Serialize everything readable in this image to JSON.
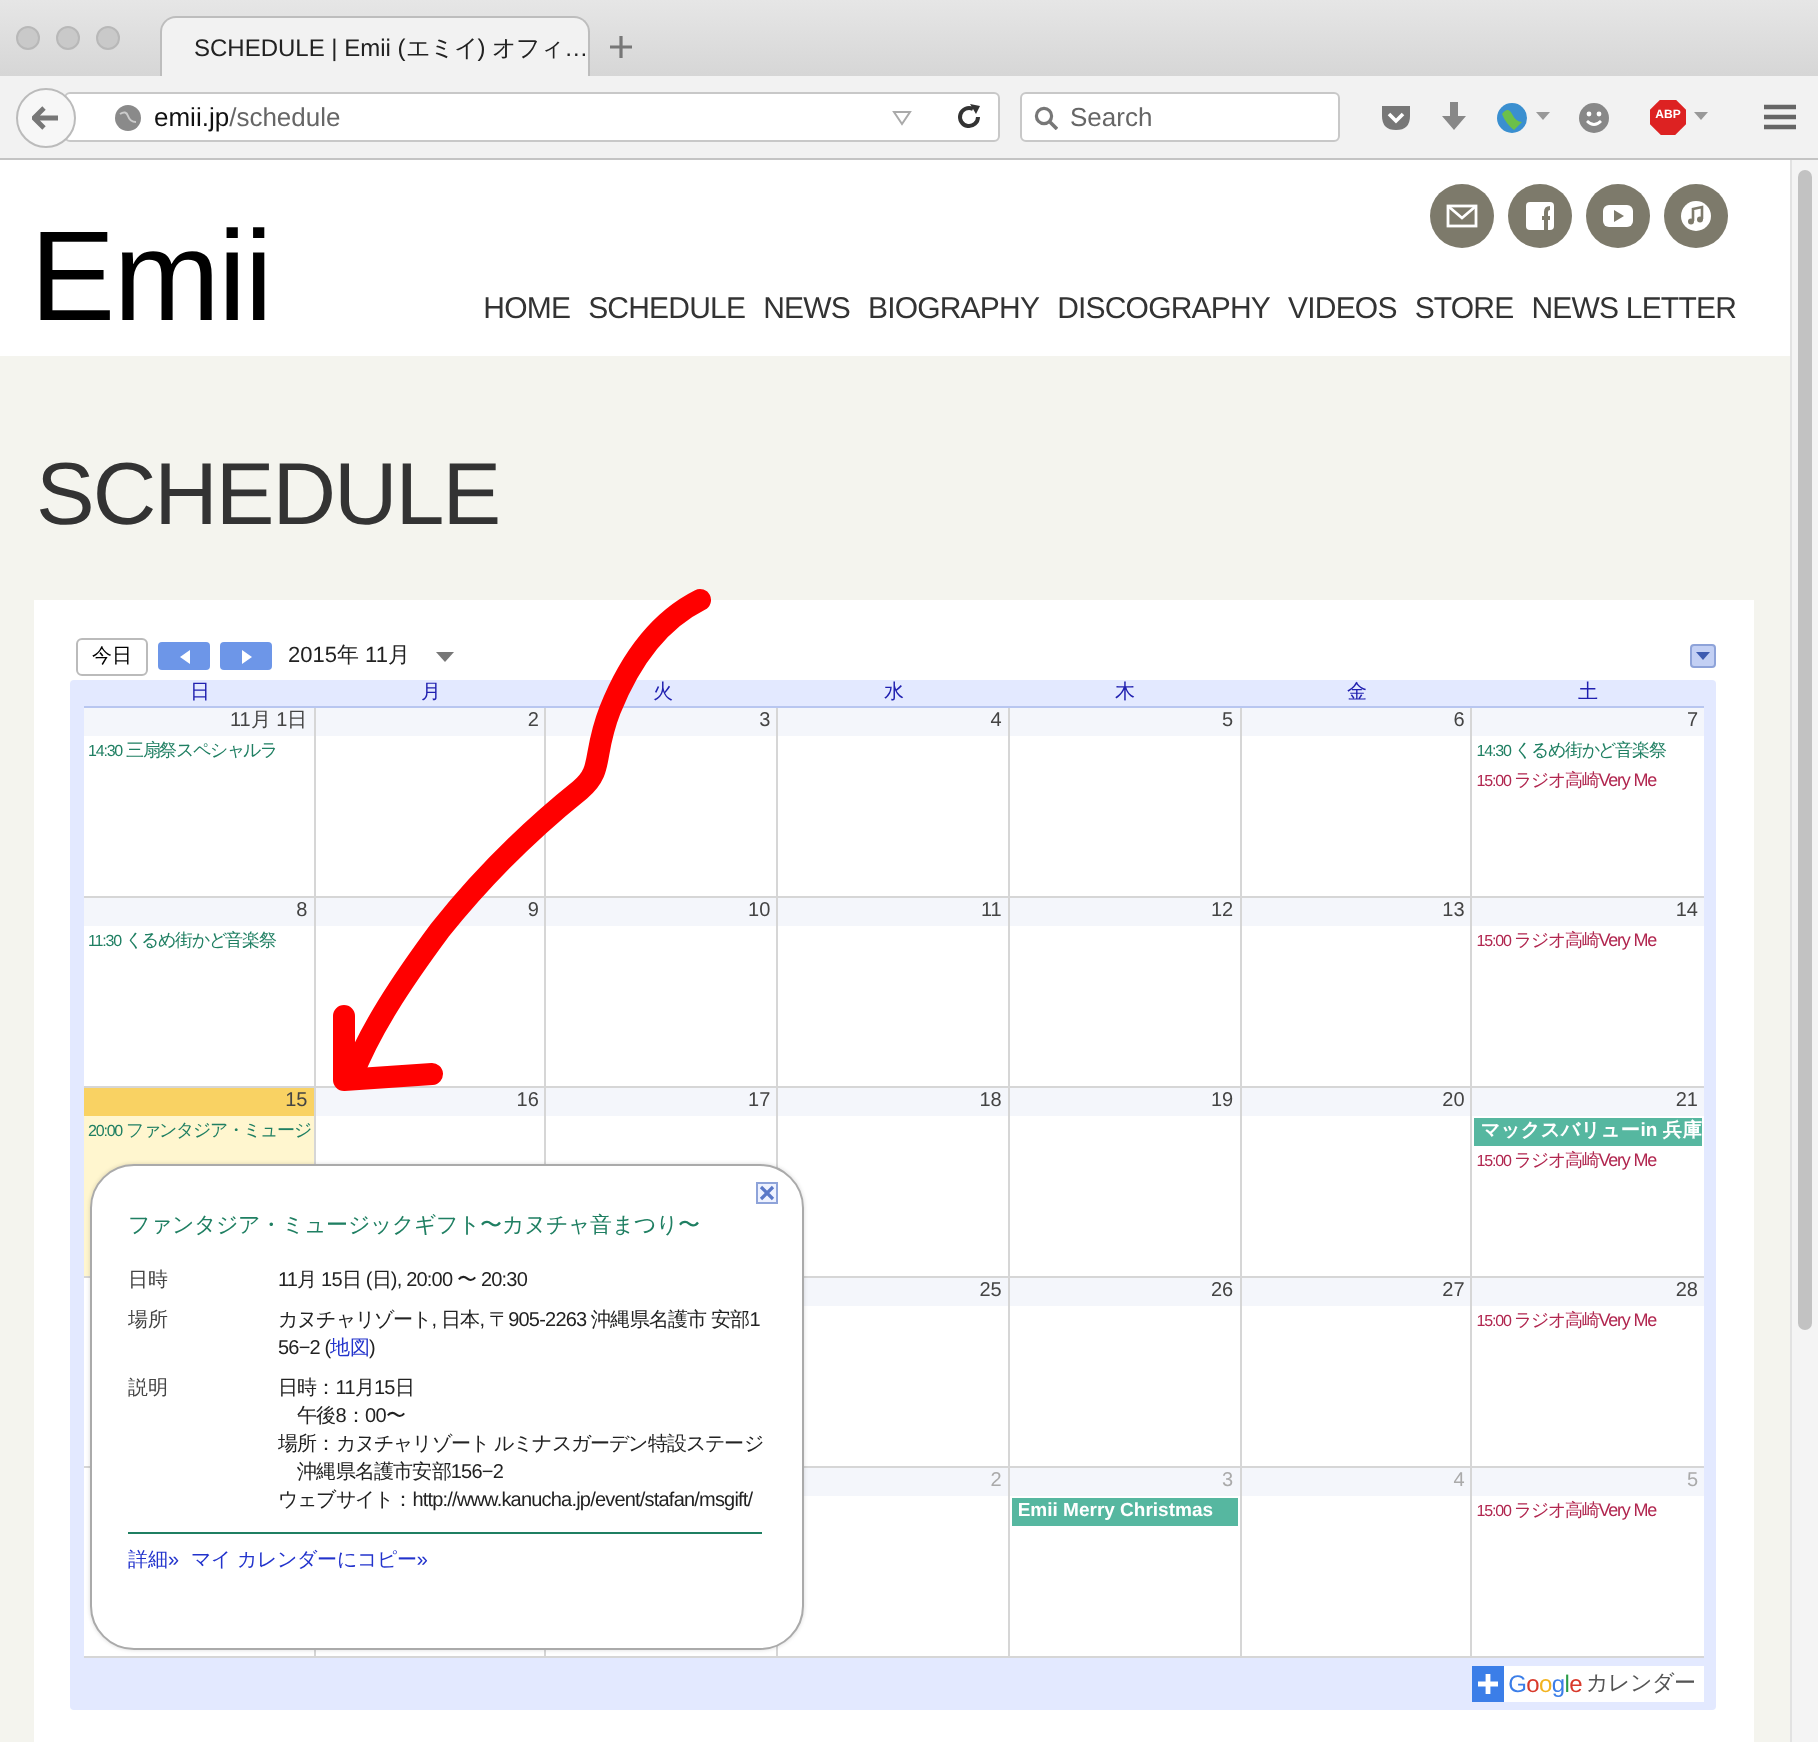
{
  "browser": {
    "tab_title": "SCHEDULE | Emii (エミイ) オフィ…",
    "url_host": "emii.jp",
    "url_path": "/schedule",
    "search_placeholder": "Search",
    "adblock_label": "ABP"
  },
  "site": {
    "logo": "Emii",
    "social": [
      {
        "kind": "mail"
      },
      {
        "kind": "facebook"
      },
      {
        "kind": "youtube"
      },
      {
        "kind": "music"
      }
    ],
    "nav": [
      {
        "label": "HOME"
      },
      {
        "label": "SCHEDULE"
      },
      {
        "label": "NEWS"
      },
      {
        "label": "BIOGRAPHY"
      },
      {
        "label": "DISCOGRAPHY"
      },
      {
        "label": "VIDEOS"
      },
      {
        "label": "STORE"
      },
      {
        "label": "NEWS LETTER"
      }
    ]
  },
  "page_title": "SCHEDULE",
  "calendar": {
    "today_button": "今日",
    "month": "2015年 11月",
    "weekdays": [
      "日",
      "月",
      "火",
      "水",
      "木",
      "金",
      "土"
    ],
    "weeks": [
      {
        "days": [
          {
            "label": "11月 1日",
            "other_month": false,
            "today": false,
            "events": [
              {
                "kind": "timed",
                "time": "14:30",
                "title": "三扇祭スペシャルラ",
                "color": "#1f7f62"
              }
            ]
          },
          {
            "label": "2",
            "other_month": false,
            "today": false
          },
          {
            "label": "3",
            "other_month": false,
            "today": false
          },
          {
            "label": "4",
            "other_month": false,
            "today": false
          },
          {
            "label": "5",
            "other_month": false,
            "today": false
          },
          {
            "label": "6",
            "other_month": false,
            "today": false
          },
          {
            "label": "7",
            "other_month": false,
            "today": false,
            "events": [
              {
                "kind": "timed",
                "time": "14:30",
                "title": "くるめ街かど音楽祭",
                "color": "#1f7f62"
              },
              {
                "kind": "timed",
                "time": "15:00",
                "title": "ラジオ高崎Very Me",
                "color": "#b1264f"
              }
            ]
          }
        ]
      },
      {
        "days": [
          {
            "label": "8",
            "other_month": false,
            "today": false,
            "events": [
              {
                "kind": "timed",
                "time": "11:30",
                "title": "くるめ街かど音楽祭",
                "color": "#1f7f62"
              }
            ]
          },
          {
            "label": "9",
            "other_month": false,
            "today": false
          },
          {
            "label": "10",
            "other_month": false,
            "today": false
          },
          {
            "label": "11",
            "other_month": false,
            "today": false
          },
          {
            "label": "12",
            "other_month": false,
            "today": false
          },
          {
            "label": "13",
            "other_month": false,
            "today": false
          },
          {
            "label": "14",
            "other_month": false,
            "today": false,
            "events": [
              {
                "kind": "timed",
                "time": "15:00",
                "title": "ラジオ高崎Very Me",
                "color": "#b1264f"
              }
            ]
          }
        ]
      },
      {
        "days": [
          {
            "label": "15",
            "other_month": false,
            "today": true,
            "events": [
              {
                "kind": "timed",
                "time": "20:00",
                "title": "ファンタジア・ミュージ",
                "color": "#1f7f62"
              }
            ]
          },
          {
            "label": "16",
            "other_month": false,
            "today": false
          },
          {
            "label": "17",
            "other_month": false,
            "today": false
          },
          {
            "label": "18",
            "other_month": false,
            "today": false
          },
          {
            "label": "19",
            "other_month": false,
            "today": false
          },
          {
            "label": "20",
            "other_month": false,
            "today": false
          },
          {
            "label": "21",
            "other_month": false,
            "today": false,
            "events": [
              {
                "kind": "allday",
                "title": "マックスバリューin 兵庫",
                "color": "#56b7a0"
              },
              {
                "kind": "timed",
                "time": "15:00",
                "title": "ラジオ高崎Very Me",
                "color": "#b1264f"
              }
            ]
          }
        ]
      },
      {
        "days": [
          {
            "label": "25",
            "other_month": false,
            "today": false
          },
          {
            "label": "26",
            "other_month": false,
            "today": false
          },
          {
            "label": "27",
            "other_month": false,
            "today": false
          },
          {
            "label": "28",
            "other_month": false,
            "today": false,
            "events": [
              {
                "kind": "timed",
                "time": "15:00",
                "title": "ラジオ高崎Very Me",
                "color": "#b1264f"
              }
            ]
          }
        ]
      },
      {
        "days": [
          {
            "label": "2",
            "other_month": true,
            "today": false
          },
          {
            "label": "3",
            "other_month": true,
            "today": false,
            "events": [
              {
                "kind": "allday",
                "title": "Emii Merry Christmas",
                "color": "#56b7a0"
              }
            ]
          },
          {
            "label": "4",
            "other_month": true,
            "today": false
          },
          {
            "label": "5",
            "other_month": true,
            "today": false,
            "events": [
              {
                "kind": "timed",
                "time": "15:00",
                "title": "ラジオ高崎Very Me",
                "color": "#b1264f"
              }
            ]
          }
        ]
      }
    ],
    "badge": {
      "brand": "Google",
      "label": "カレンダー"
    }
  },
  "popup": {
    "title": "ファンタジア・ミュージックギフト〜カヌチャ音まつり〜",
    "rows": [
      {
        "label": "日時",
        "text": "11月 15日 (日), 20:00 〜 20:30"
      },
      {
        "label": "場所",
        "text": "カヌチャリゾート, 日本, 〒905-2263 沖縄県名護市 安部156−2 (",
        "link": "地図",
        "after": ")"
      },
      {
        "label": "説明",
        "lines": [
          "日時：11月15日",
          "　午後8：00〜",
          "場所：カヌチャリゾート ルミナスガーデン特設ステージ",
          "　沖縄県名護市安部156−2",
          "ウェブサイト：http://www.kanucha.jp/event/stafan/msgift/"
        ]
      }
    ],
    "links": [
      "詳細»",
      "マイ カレンダーにコピー»"
    ]
  }
}
